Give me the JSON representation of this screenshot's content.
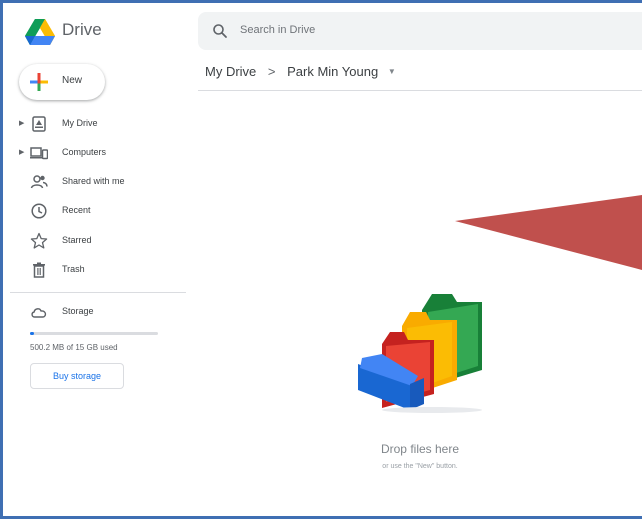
{
  "app": {
    "name": "Drive"
  },
  "search": {
    "placeholder": "Search in Drive"
  },
  "sidebar": {
    "new_label": "New",
    "items": [
      {
        "label": "My Drive",
        "icon": "my-drive-icon",
        "expandable": true
      },
      {
        "label": "Computers",
        "icon": "computers-icon",
        "expandable": true
      },
      {
        "label": "Shared with me",
        "icon": "shared-with-me-icon",
        "expandable": false
      },
      {
        "label": "Recent",
        "icon": "clock-icon",
        "expandable": false
      },
      {
        "label": "Starred",
        "icon": "star-icon",
        "expandable": false
      },
      {
        "label": "Trash",
        "icon": "trash-icon",
        "expandable": false
      }
    ],
    "storage": {
      "label": "Storage",
      "usage_text": "500.2 MB of 15 GB used",
      "used_fraction": 0.033,
      "buy_label": "Buy storage"
    }
  },
  "breadcrumb": {
    "root": "My Drive",
    "separator": ">",
    "current": "Park Min Young"
  },
  "empty_state": {
    "title": "Drop files here",
    "subtitle": "or use the \"New\" button."
  },
  "colors": {
    "accent": "#1a73e8",
    "arrow": "#c0504d",
    "frame": "#3f6fb3"
  }
}
